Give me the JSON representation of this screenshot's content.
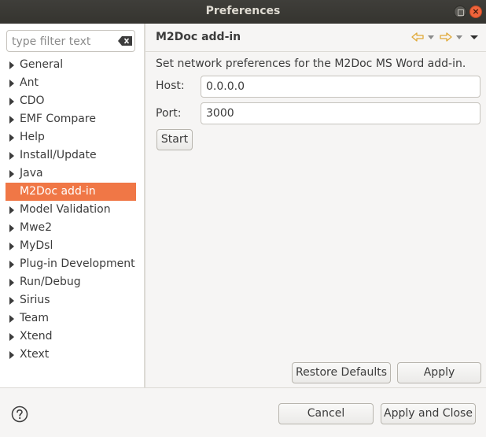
{
  "window": {
    "title": "Preferences"
  },
  "filter": {
    "placeholder": "type filter text",
    "value": ""
  },
  "tree": [
    {
      "label": "General",
      "expandable": true,
      "selected": false
    },
    {
      "label": "Ant",
      "expandable": true,
      "selected": false
    },
    {
      "label": "CDO",
      "expandable": true,
      "selected": false
    },
    {
      "label": "EMF Compare",
      "expandable": true,
      "selected": false
    },
    {
      "label": "Help",
      "expandable": true,
      "selected": false
    },
    {
      "label": "Install/Update",
      "expandable": true,
      "selected": false
    },
    {
      "label": "Java",
      "expandable": true,
      "selected": false
    },
    {
      "label": "M2Doc add-in",
      "expandable": false,
      "selected": true
    },
    {
      "label": "Model Validation",
      "expandable": true,
      "selected": false
    },
    {
      "label": "Mwe2",
      "expandable": true,
      "selected": false
    },
    {
      "label": "MyDsl",
      "expandable": true,
      "selected": false
    },
    {
      "label": "Plug-in Development",
      "expandable": true,
      "selected": false
    },
    {
      "label": "Run/Debug",
      "expandable": true,
      "selected": false
    },
    {
      "label": "Sirius",
      "expandable": true,
      "selected": false
    },
    {
      "label": "Team",
      "expandable": true,
      "selected": false
    },
    {
      "label": "Xtend",
      "expandable": true,
      "selected": false
    },
    {
      "label": "Xtext",
      "expandable": true,
      "selected": false
    }
  ],
  "page": {
    "title": "M2Doc add-in",
    "description": "Set network preferences for the M2Doc MS Word add-in.",
    "host_label": "Host:",
    "host_value": "0.0.0.0",
    "port_label": "Port:",
    "port_value": "3000",
    "start_label": "Start"
  },
  "page_buttons": {
    "restore_defaults": "Restore Defaults",
    "apply": "Apply"
  },
  "dialog_buttons": {
    "cancel": "Cancel",
    "apply_and_close": "Apply and Close"
  },
  "icons": {
    "back": "arrow-left-icon",
    "forward": "arrow-right-icon",
    "view_menu": "chevron-down-icon",
    "help": "help-icon",
    "clear": "clear-filter-icon"
  },
  "colors": {
    "selection": "#f07746",
    "titlebar": "#3a3935",
    "close_button": "#f0643b",
    "nav_arrow": "#e8b84a"
  }
}
